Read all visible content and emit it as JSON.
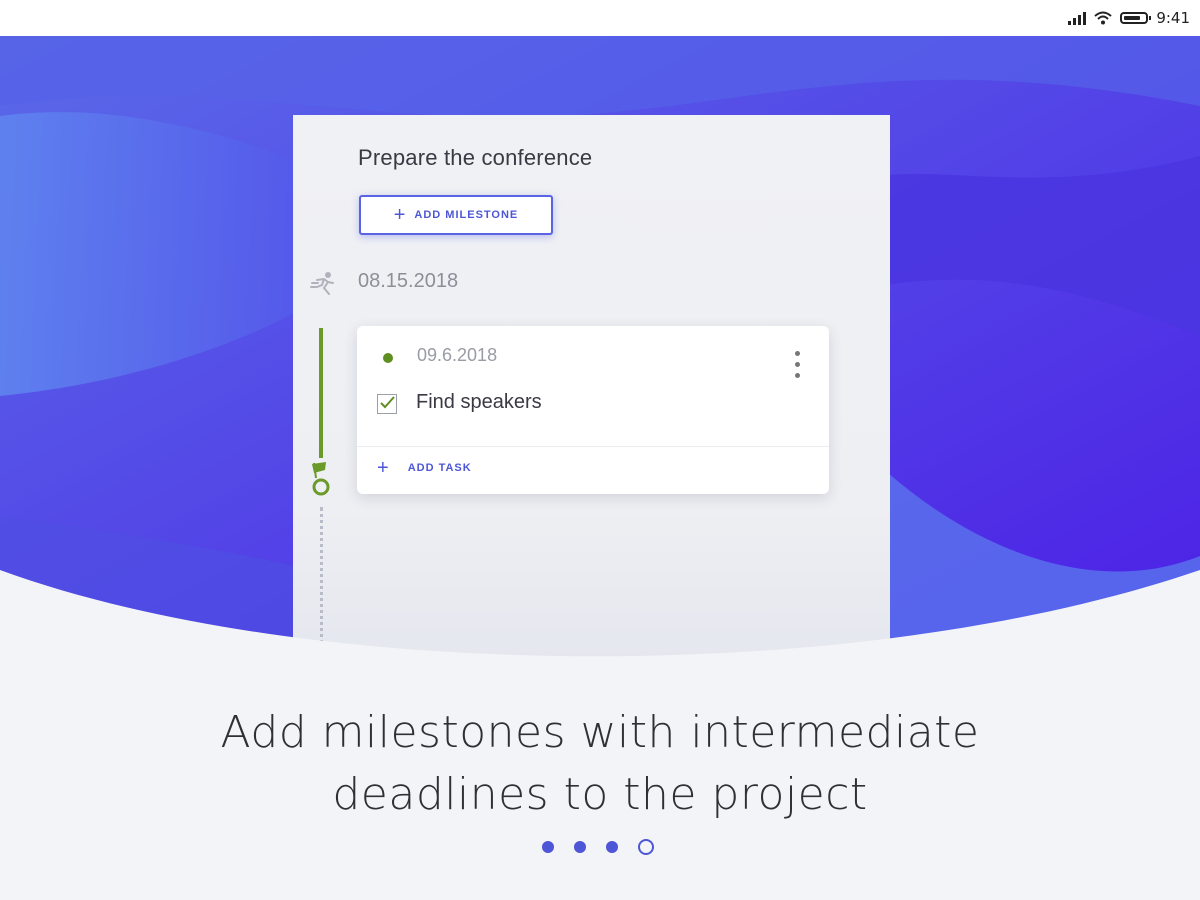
{
  "status_bar": {
    "time": "9:41",
    "battery_level": 0.8
  },
  "card": {
    "title": "Prepare the conference",
    "add_milestone_label": "ADD MILESTONE",
    "milestone_date": "08.15.2018",
    "task_card": {
      "date": "09.6.2018",
      "task_name": "Find speakers",
      "task_checked": true,
      "add_task_label": "ADD TASK"
    }
  },
  "caption": {
    "line1": "Add milestones with intermediate",
    "line2": "deadlines to the project"
  },
  "pager": {
    "total": 4,
    "current": 4
  },
  "colors": {
    "accent": "#4d56d6",
    "hero_start": "#5b63e6",
    "hero_end": "#4a1fe8",
    "milestone_green": "#6a9a2a"
  }
}
